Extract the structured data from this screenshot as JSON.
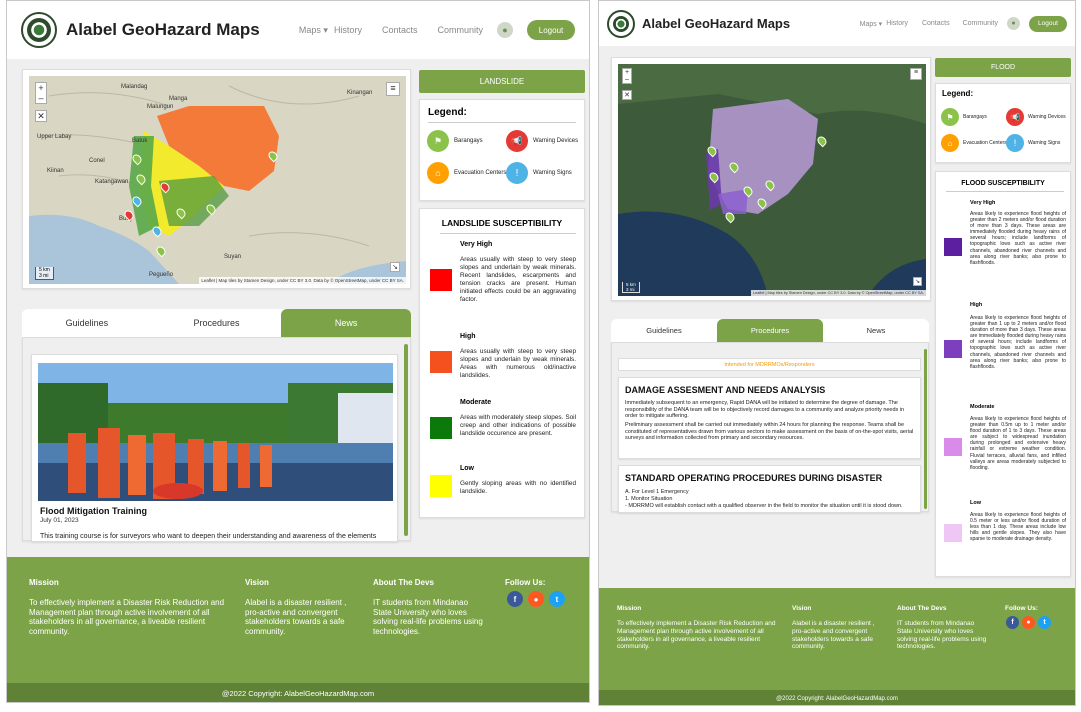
{
  "left": {
    "brand": "Alabel GeoHazard Maps",
    "nav": {
      "maps": "Maps ▾",
      "history": "History",
      "contacts": "Contacts",
      "community": "Community",
      "logout": "Logout"
    },
    "map_places": [
      "Malandag",
      "Manga",
      "Malungun",
      "Kinangan",
      "Upper Labay",
      "Batuk",
      "Conel",
      "Kiinan",
      "Katangawan",
      "Buay",
      "Suyan",
      "Pegueño"
    ],
    "scale": [
      "5 km",
      "3 mi"
    ],
    "attribution": "Leaflet | Map tiles by Stamen Design, under CC BY 3.0. Data by © OpenStreetMap, under CC BY SA.",
    "hazard": "LANDSLIDE",
    "legend_title": "Legend:",
    "legend": [
      "Barangays",
      "Warning Devices",
      "Evacuation Centers",
      "Warning Signs"
    ],
    "sus_title": "LANDSLIDE SUSCEPTIBILITY",
    "sus": [
      {
        "level": "Very High",
        "color": "#ff0000",
        "text": "Areas usually with steep to very steep slopes and underlain by weak minerals. Recent landslides, escarpments and tension cracks are present. Human initiated effects could be an aggravating factor."
      },
      {
        "level": "High",
        "color": "#f4511e",
        "text": "Areas usually with steep to very steep slopes and underlain by weak minerals. Areas with numerous old/inactive landslides."
      },
      {
        "level": "Moderate",
        "color": "#0b7a0b",
        "text": "Areas with moderately steep slopes. Soil creep and other indications of possible landslide occurence are present."
      },
      {
        "level": "Low",
        "color": "#ffff00",
        "text": "Gently sloping areas with no identified landslide."
      }
    ],
    "tabs": [
      "Guidelines",
      "Procedures",
      "News"
    ],
    "news": {
      "title": "Flood Mitigation Training",
      "date": "July 01, 2023",
      "body": "This training course is for surveyors who want to deepen their understanding and awareness of the elements"
    }
  },
  "right": {
    "brand": "Alabel GeoHazard Maps",
    "nav": {
      "maps": "Maps ▾",
      "history": "History",
      "contacts": "Contacts",
      "community": "Community",
      "logout": "Logout"
    },
    "scale": [
      "5 km",
      "3 mi"
    ],
    "attribution": "Leaflet | Map tiles by Stamen Design, under CC BY 3.0. Data by © OpenStreetMap, under CC BY SA.",
    "hazard": "FLOOD",
    "legend_title": "Legend:",
    "legend": [
      "Barangays",
      "Warning Devices",
      "Evacuation Centers",
      "Warning Signs"
    ],
    "sus_title": "FLOOD SUSCEPTIBILITY",
    "sus": [
      {
        "level": "Very High",
        "color": "#5b1fa0",
        "text": "Areas likely to experience flood heights of greater than 2 meters and/or flood duration of more than 3 days. These areas are immediately flooded during heavy rains of several hours; include landforms of topographic lows such as active river channels, abandoned river channels and area along river banks; also prone to flashfloods."
      },
      {
        "level": "High",
        "color": "#7e3fbf",
        "text": "Areas likely to experience flood heights of greater than 1 up to 2 meters and/or flood duration of more than 3 days. These areas are immediately flooded during heavy rains of several hours; include landforms of topographic lows such as active river channels, abandoned river channels and area along river banks; also prone to flashfloods."
      },
      {
        "level": "Moderate",
        "color": "#d88be8",
        "text": "Areas likely to experience flood heights of greater than 0.5m up to 1 meter and/or flood duration of 1 to 3 days. These areas are subject to widespread inundation during prolonged and extensive heavy rainfall or extreme weather condition. Fluvial terraces, alluvial fans, and infilled valleys are areas moderately subjected to flooding."
      },
      {
        "level": "Low",
        "color": "#efc7f5",
        "text": "Areas likely to experience flood heights of 0.5 meter or less and/or flood duration of less than 1 day. These areas include low hills and gentle slopes. They also have sparse to moderate drainage density."
      }
    ],
    "tabs": [
      "Guidelines",
      "Procedures",
      "News"
    ],
    "intended": "Intended for MDRRMOs/Responders",
    "sec1_title": "DAMAGE ASSESMENT AND NEEDS ANALYSIS",
    "sec1_p1": "Immediately subsequent to an emergency, Rapid DANA will be initiated to determine the degree of damage. The responsibility of the DANA team will be to objectively record damages to a community and analyze priority needs in order to mitigate suffering.",
    "sec1_p2": "Preliminary assessment shall be carried out immediately within 24 hours for planning the response. Teams shall be constituted of representatives drawn from various sectors to make assessment on the basis of on-the-spot visits, aerial surveys and information collected from primary and secondary resources.",
    "sec2_title": "STANDARD OPERATING PROCEDURES DURING DISASTER",
    "sec2_l1": "A. For Level 1 Emergency",
    "sec2_l2": "1. Monitor Situation",
    "sec2_l3": "- MDRRMO will establish contact with a qualified observer in the field to monitor the situation until it is stood down."
  },
  "footer": {
    "mission_h": "Mission",
    "mission": "To effectively implement a Disaster Risk Reduction and Management plan through active involvement of all stakeholders in all governance, a liveable resilient community.",
    "vision_h": "Vision",
    "vision": "Alabel is a disaster resilient , pro-active and convergent stakeholders towards a safe community.",
    "devs_h": "About The Devs",
    "devs": "IT students from Mindanao State University who loves solving real-life problems using technologies.",
    "follow": "Follow Us:",
    "copyright": "@2022 Copyright: AlabelGeoHazardMap.com"
  },
  "colors": {
    "accent": "#7da348",
    "footer": "#7da348",
    "copy": "#5f8236"
  }
}
